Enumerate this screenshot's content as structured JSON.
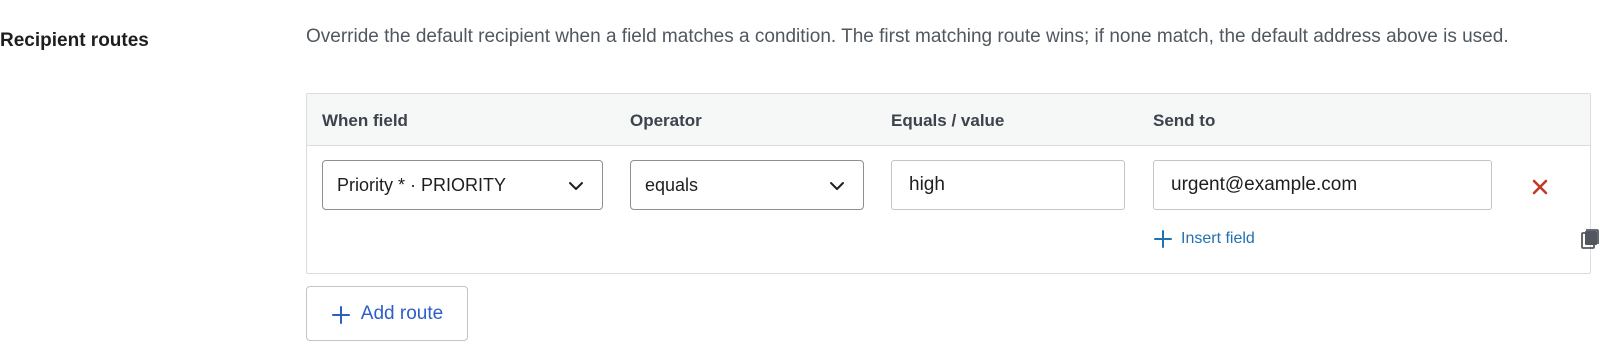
{
  "section": {
    "label": "Recipient routes",
    "description": "Override the default recipient when a field matches a condition. The first matching route wins; if none match, the default address above is used."
  },
  "table": {
    "headers": {
      "field": "When field",
      "operator": "Operator",
      "value": "Equals / value",
      "send_to": "Send to"
    },
    "rows": [
      {
        "field": "Priority * · PRIORITY",
        "operator": "equals",
        "value": "high",
        "send_to": "urgent@example.com",
        "insert_field_label": "Insert field"
      }
    ]
  },
  "add_route_label": "Add route",
  "colors": {
    "accent": "#2271b1",
    "add_button_text": "#2c5ec9",
    "remove": "#c0392b",
    "header_bg": "#f6f7f7",
    "border": "#dcdcde"
  },
  "icons": {
    "dropdown": "chevron-down-icon",
    "remove": "close-icon",
    "insert": "plus-icon",
    "copy": "copy-icon"
  }
}
